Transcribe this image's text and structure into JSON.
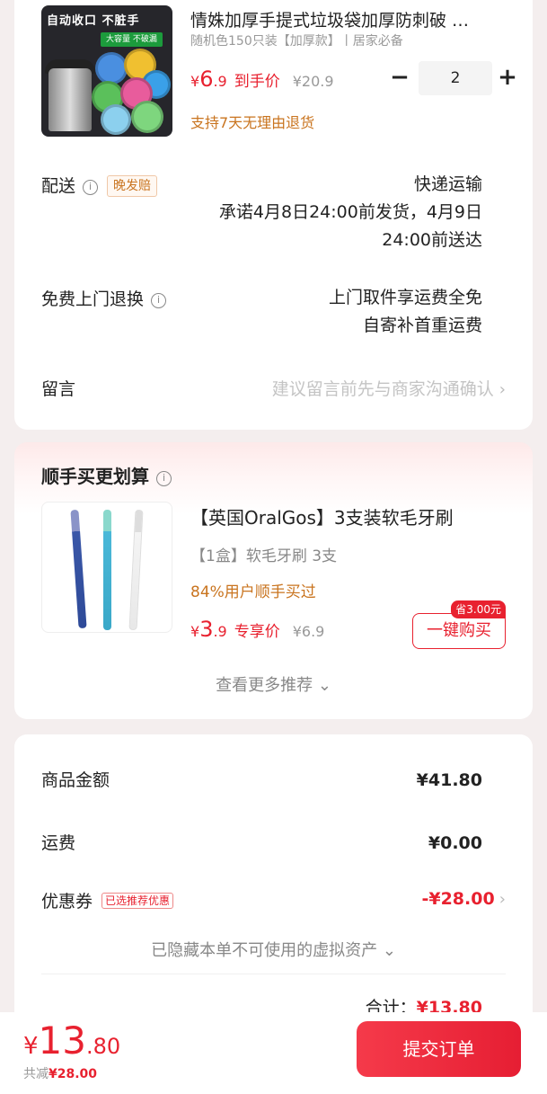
{
  "product": {
    "image_banner": "自动收口 不脏手",
    "image_subbanner": "大容量 不破漏",
    "title": "情姝加厚手提式垃圾袋加厚防刺破 …",
    "spec": "随机色150只装【加厚款】丨居家必备",
    "price_currency": "¥",
    "price_int": "6",
    "price_dec": ".9",
    "price_label": "到手价",
    "original_price": "¥20.9",
    "quantity": "2",
    "minus_icon": "minus-icon",
    "plus_icon": "plus-icon",
    "return_policy": "支持7天无理由退货"
  },
  "delivery": {
    "label": "配送",
    "tag": "晚发赔",
    "method": "快递运输",
    "promise_line1": "承诺4月8日24:00前发货，4月9日",
    "promise_line2": "24:00前送达"
  },
  "free_return": {
    "label": "免费上门退换",
    "line1": "上门取件享运费全免",
    "line2": "自寄补首重运费"
  },
  "message": {
    "label": "留言",
    "placeholder": "建议留言前先与商家沟通确认",
    "chevron": "›"
  },
  "addon": {
    "section_title": "顺手买更划算",
    "title": "【英国OralGos】3支装软毛牙刷",
    "spec": "【1盒】软毛牙刷 3支",
    "users": "84%用户顺手买过",
    "price_currency": "¥",
    "price_int": "3",
    "price_dec": ".9",
    "price_label": "专享价",
    "original_price": "¥6.9",
    "save_badge": "省3.00元",
    "buy_button": "一键购买",
    "more": "查看更多推荐",
    "more_chevron": "⌄"
  },
  "summary": {
    "goods_label": "商品金额",
    "goods_value": "¥41.80",
    "shipping_label": "运费",
    "shipping_value": "¥0.00",
    "coupon_label": "优惠券",
    "coupon_tag": "已选推荐优惠",
    "coupon_value": "-¥28.00",
    "coupon_chevron": "›",
    "hidden_assets": "已隐藏本单不可使用的虚拟资产",
    "hidden_chevron": "⌄",
    "total_label": "合计：",
    "total_value": "¥13.80"
  },
  "bottom": {
    "currency": "¥",
    "amount_int": "13",
    "amount_dec": ".80",
    "saved_label": "共减",
    "saved_value": "¥28.00",
    "submit": "提交订单"
  },
  "colors": {
    "accent_red": "#e8212f",
    "orange": "#c9741f",
    "background": "#f4eeee"
  }
}
